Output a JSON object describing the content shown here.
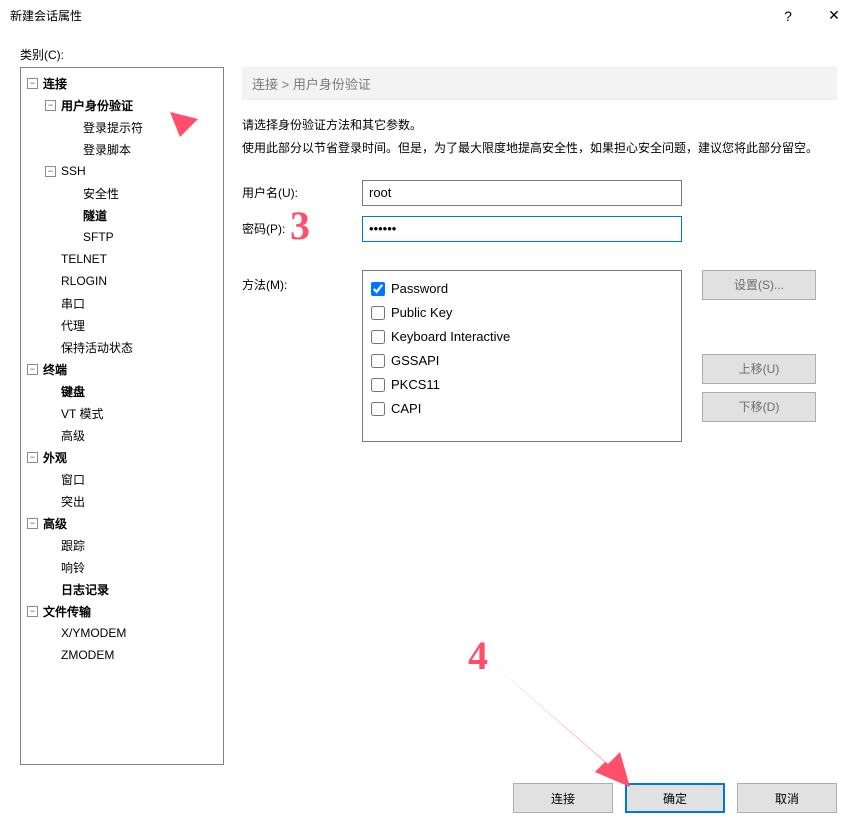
{
  "window": {
    "title": "新建会话属性",
    "help_glyph": "?",
    "close_glyph": "✕"
  },
  "category_label": "类别(C):",
  "tree": {
    "connection": "连接",
    "user_auth": "用户身份验证",
    "login_prompt": "登录提示符",
    "login_script": "登录脚本",
    "ssh": "SSH",
    "security": "安全性",
    "tunnel": "隧道",
    "sftp": "SFTP",
    "telnet": "TELNET",
    "rlogin": "RLOGIN",
    "serial": "串口",
    "proxy": "代理",
    "keepalive": "保持活动状态",
    "terminal": "终端",
    "keyboard": "键盘",
    "vtmode": "VT 模式",
    "advanced_term": "高级",
    "appearance": "外观",
    "window": "窗口",
    "highlight": "突出",
    "advanced": "高级",
    "trace": "跟踪",
    "bell": "响铃",
    "logging": "日志记录",
    "filetransfer": "文件传输",
    "xymodem": "X/YMODEM",
    "zmodem": "ZMODEM"
  },
  "main": {
    "breadcrumb": "连接 > 用户身份验证",
    "desc1": "请选择身份验证方法和其它参数。",
    "desc2": "使用此部分以节省登录时间。但是，为了最大限度地提高安全性，如果担心安全问题，建议您将此部分留空。",
    "username_label": "用户名(U):",
    "username_value": "root",
    "password_label": "密码(P):",
    "password_value": "••••••",
    "method_label": "方法(M):",
    "methods": [
      {
        "label": "Password",
        "checked": true
      },
      {
        "label": "Public Key",
        "checked": false
      },
      {
        "label": "Keyboard Interactive",
        "checked": false
      },
      {
        "label": "GSSAPI",
        "checked": false
      },
      {
        "label": "PKCS11",
        "checked": false
      },
      {
        "label": "CAPI",
        "checked": false
      }
    ],
    "btn_settings": "设置(S)...",
    "btn_moveup": "上移(U)",
    "btn_movedown": "下移(D)"
  },
  "footer": {
    "connect": "连接",
    "ok": "确定",
    "cancel": "取消"
  },
  "annotations": {
    "num3": "3",
    "num4": "4"
  }
}
